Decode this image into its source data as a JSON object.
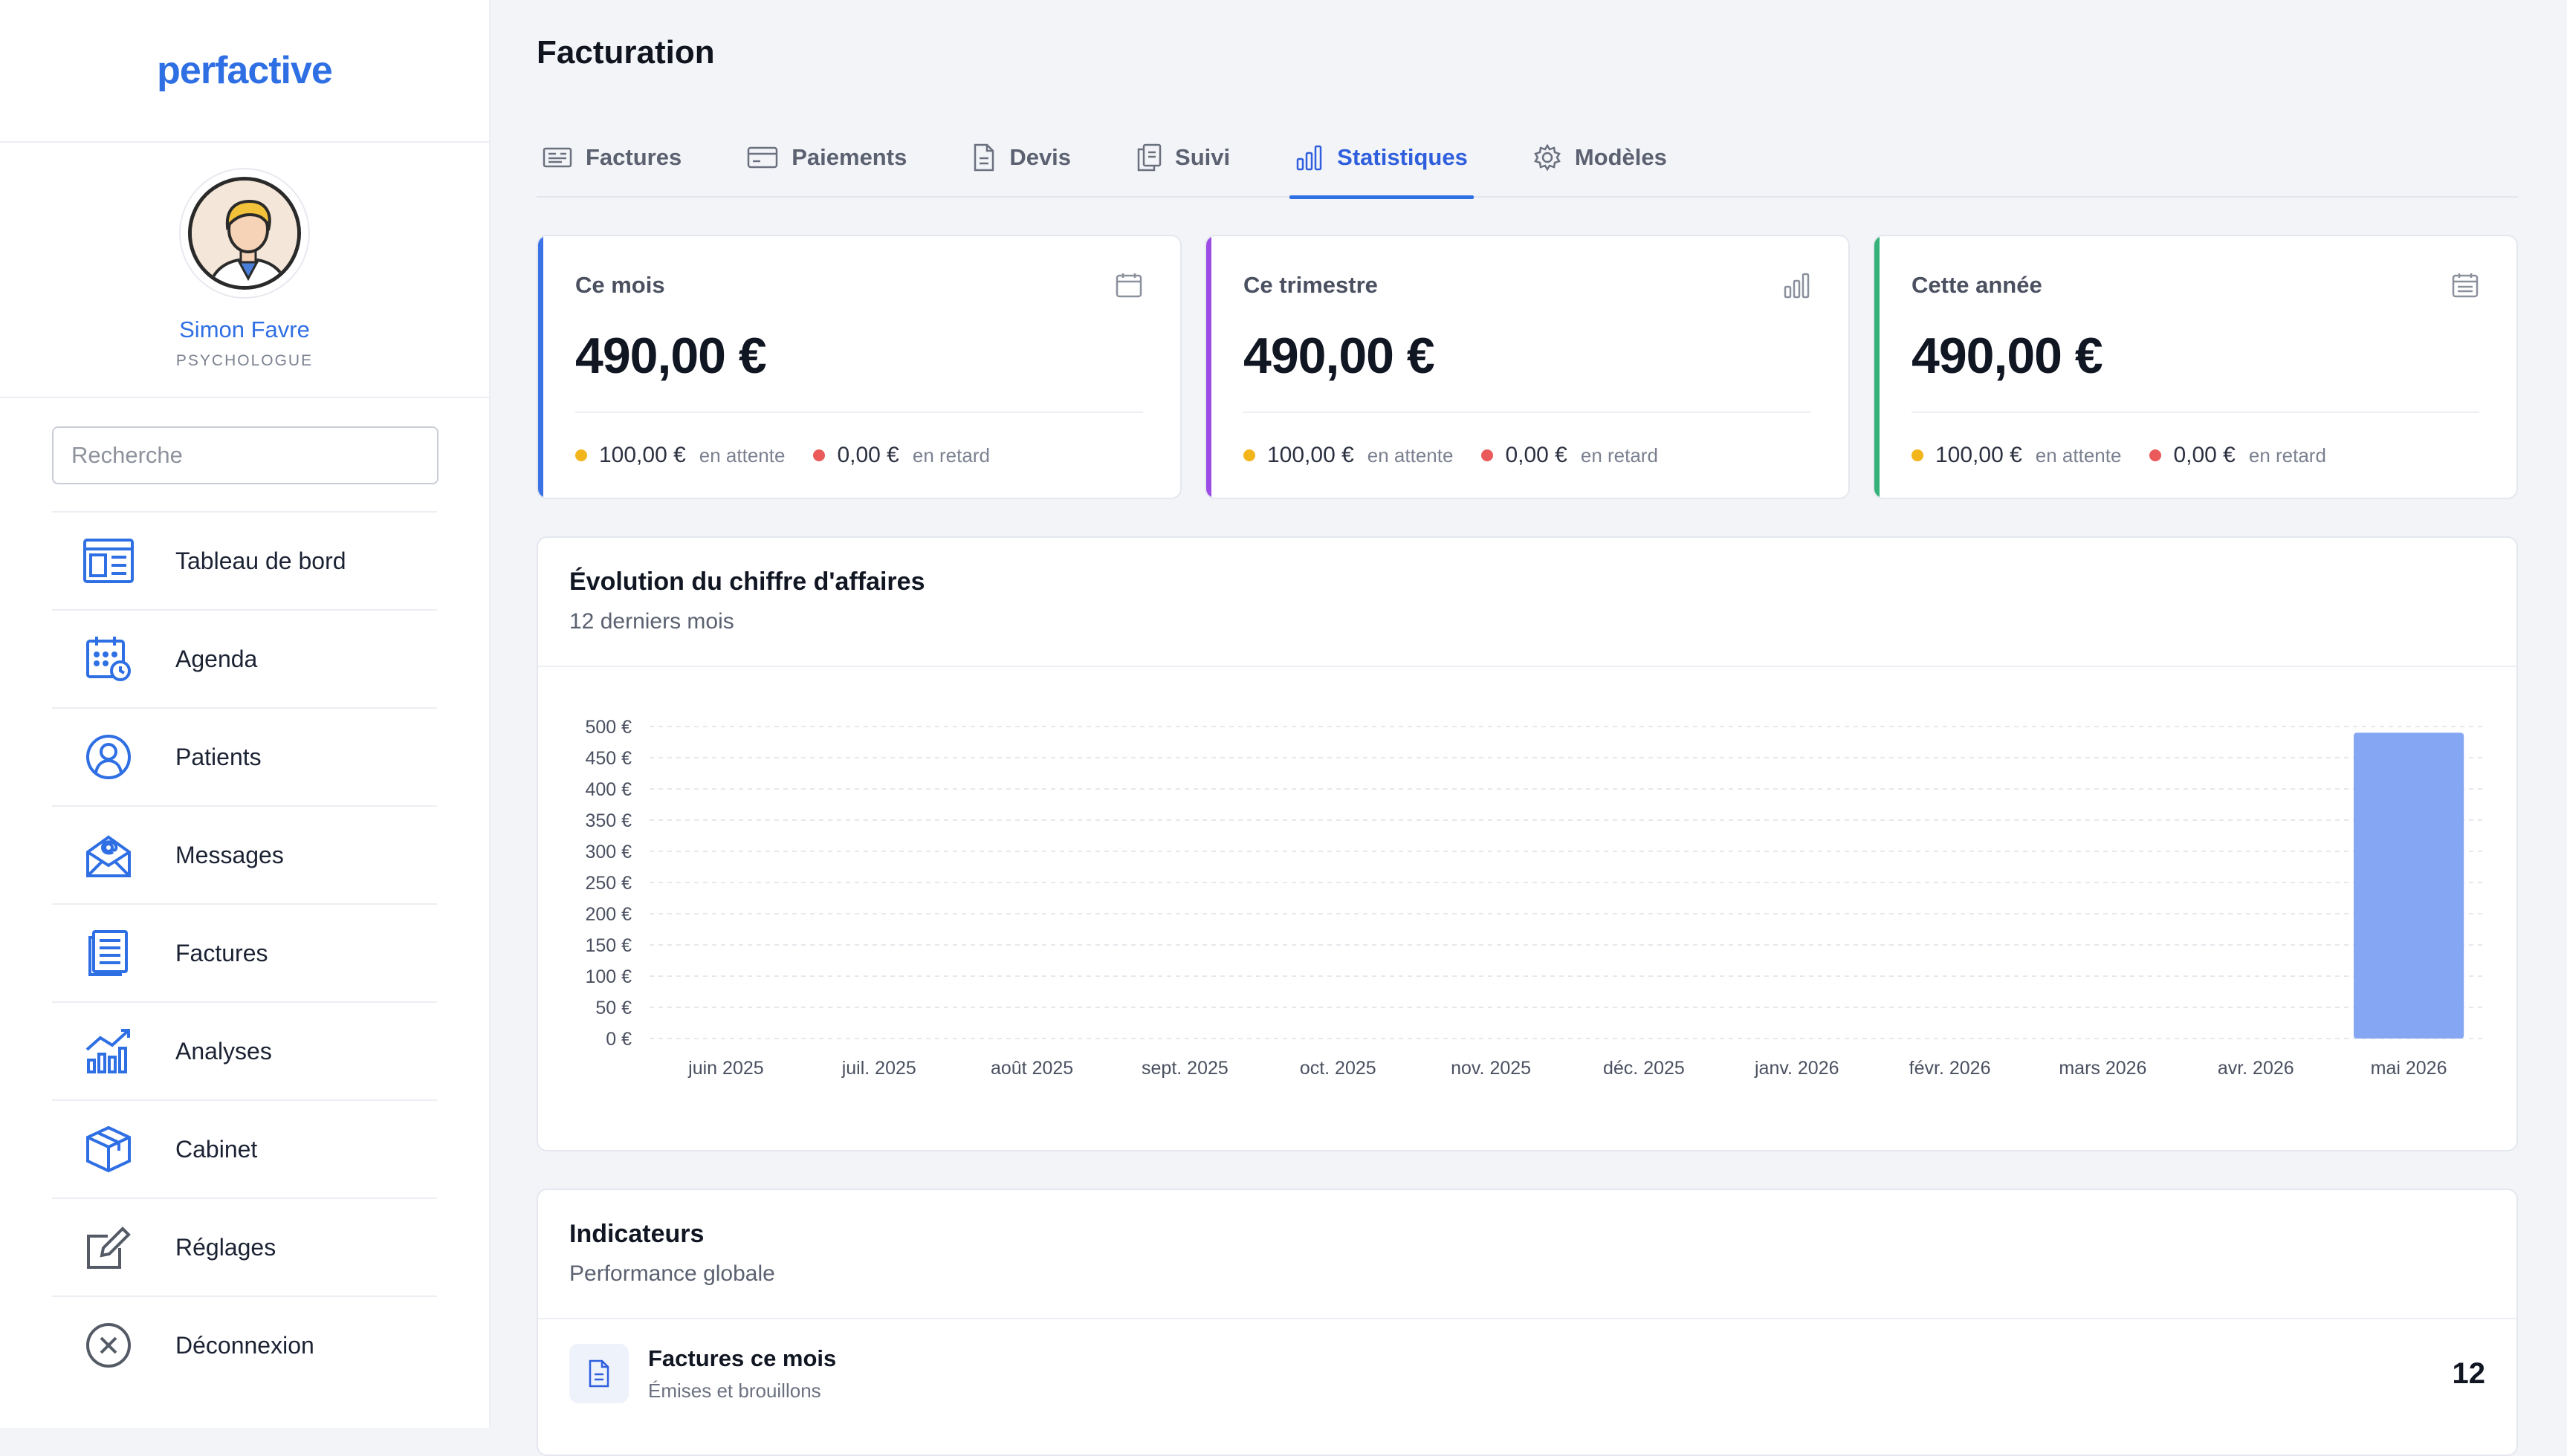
{
  "sidebar": {
    "logo": "perfactive",
    "user": {
      "name": "Simon Favre",
      "role": "PSYCHOLOGUE"
    },
    "search_placeholder": "Recherche",
    "items": [
      {
        "label": "Tableau de bord",
        "icon": "dashboard-icon"
      },
      {
        "label": "Agenda",
        "icon": "calendar-clock-icon"
      },
      {
        "label": "Patients",
        "icon": "user-circle-icon"
      },
      {
        "label": "Messages",
        "icon": "mail-at-icon"
      },
      {
        "label": "Factures",
        "icon": "document-list-icon"
      },
      {
        "label": "Analyses",
        "icon": "chart-trend-icon"
      },
      {
        "label": "Cabinet",
        "icon": "box-icon"
      },
      {
        "label": "Réglages",
        "icon": "edit-square-icon"
      },
      {
        "label": "Déconnexion",
        "icon": "close-circle-icon"
      }
    ]
  },
  "page": {
    "title": "Facturation"
  },
  "tabs": [
    {
      "label": "Factures",
      "icon": "invoice-icon",
      "active": false
    },
    {
      "label": "Paiements",
      "icon": "credit-card-icon",
      "active": false
    },
    {
      "label": "Devis",
      "icon": "file-icon",
      "active": false
    },
    {
      "label": "Suivi",
      "icon": "clipboard-copy-icon",
      "active": false
    },
    {
      "label": "Statistiques",
      "icon": "bar-chart-icon",
      "active": true
    },
    {
      "label": "Modèles",
      "icon": "gear-icon",
      "active": false
    }
  ],
  "cards": [
    {
      "title": "Ce mois",
      "amount": "490,00 €",
      "pending": "100,00 €",
      "pending_label": "en attente",
      "late": "0,00 €",
      "late_label": "en retard",
      "accent": "#3b72e8",
      "icon": "calendar-icon"
    },
    {
      "title": "Ce trimestre",
      "amount": "490,00 €",
      "pending": "100,00 €",
      "pending_label": "en attente",
      "late": "0,00 €",
      "late_label": "en retard",
      "accent": "#9b4de6",
      "icon": "bar-chart-icon"
    },
    {
      "title": "Cette année",
      "amount": "490,00 €",
      "pending": "100,00 €",
      "pending_label": "en attente",
      "late": "0,00 €",
      "late_label": "en retard",
      "accent": "#35b27a",
      "icon": "calendar-grid-icon"
    }
  ],
  "colors": {
    "pending_dot": "#f2b51b",
    "late_dot": "#ea5a5a",
    "bar": "#85a6f2"
  },
  "chart_panel": {
    "title": "Évolution du chiffre d'affaires",
    "subtitle": "12 derniers mois"
  },
  "chart_data": {
    "type": "bar",
    "categories": [
      "juin 2025",
      "juil. 2025",
      "août 2025",
      "sept. 2025",
      "oct. 2025",
      "nov. 2025",
      "déc. 2025",
      "janv. 2026",
      "févr. 2026",
      "mars 2026",
      "avr. 2026",
      "mai 2026"
    ],
    "values": [
      0,
      0,
      0,
      0,
      0,
      0,
      0,
      0,
      0,
      0,
      0,
      490
    ],
    "ylim": [
      0,
      500
    ],
    "yticks": [
      "0 €",
      "50 €",
      "100 €",
      "150 €",
      "200 €",
      "250 €",
      "300 €",
      "350 €",
      "400 €",
      "450 €",
      "500 €"
    ],
    "grid": true
  },
  "indicators": {
    "title": "Indicateurs",
    "subtitle": "Performance globale",
    "rows": [
      {
        "name": "Factures ce mois",
        "desc": "Émises et brouillons",
        "value": "12",
        "icon": "file-text-icon"
      }
    ]
  }
}
